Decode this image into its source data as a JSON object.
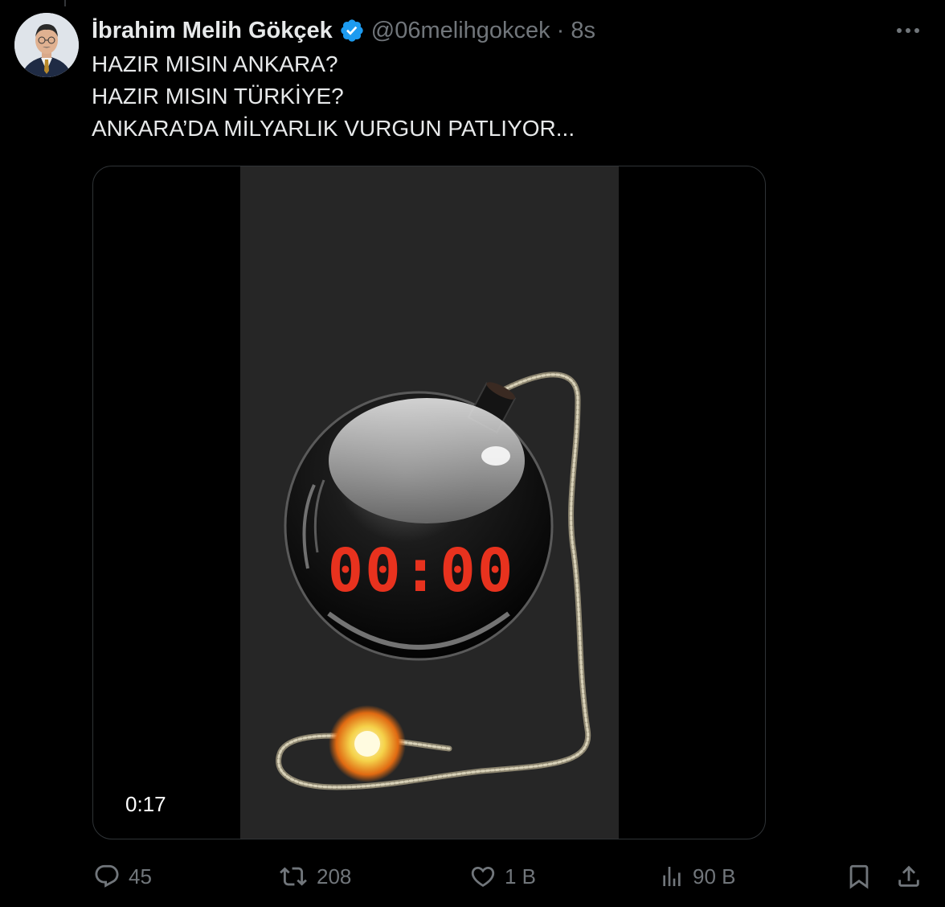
{
  "tweet": {
    "display_name": "İbrahim Melih Gökçek",
    "handle": "@06melihgokcek",
    "separator": "·",
    "time": "8s",
    "lines": [
      "HAZIR MISIN ANKARA?",
      "HAZIR MISIN TÜRKİYE?",
      "ANKARA’DA MİLYARLIK VURGUN PATLIYOR..."
    ]
  },
  "video": {
    "duration": "0:17",
    "timer_text": "00:00",
    "timer_color": "#e8321e"
  },
  "actions": {
    "replies": "45",
    "reposts": "208",
    "likes": "1 B",
    "views": "90 B"
  },
  "icons": {
    "verified": "verified-badge-icon",
    "more": "more-dots-icon",
    "reply": "reply-icon",
    "repost": "repost-icon",
    "like": "heart-icon",
    "views": "views-chart-icon",
    "bookmark": "bookmark-icon",
    "share": "share-icon"
  },
  "colors": {
    "background": "#000000",
    "text": "#e7e9ea",
    "muted": "#71767b",
    "verified": "#1d9bf0"
  }
}
